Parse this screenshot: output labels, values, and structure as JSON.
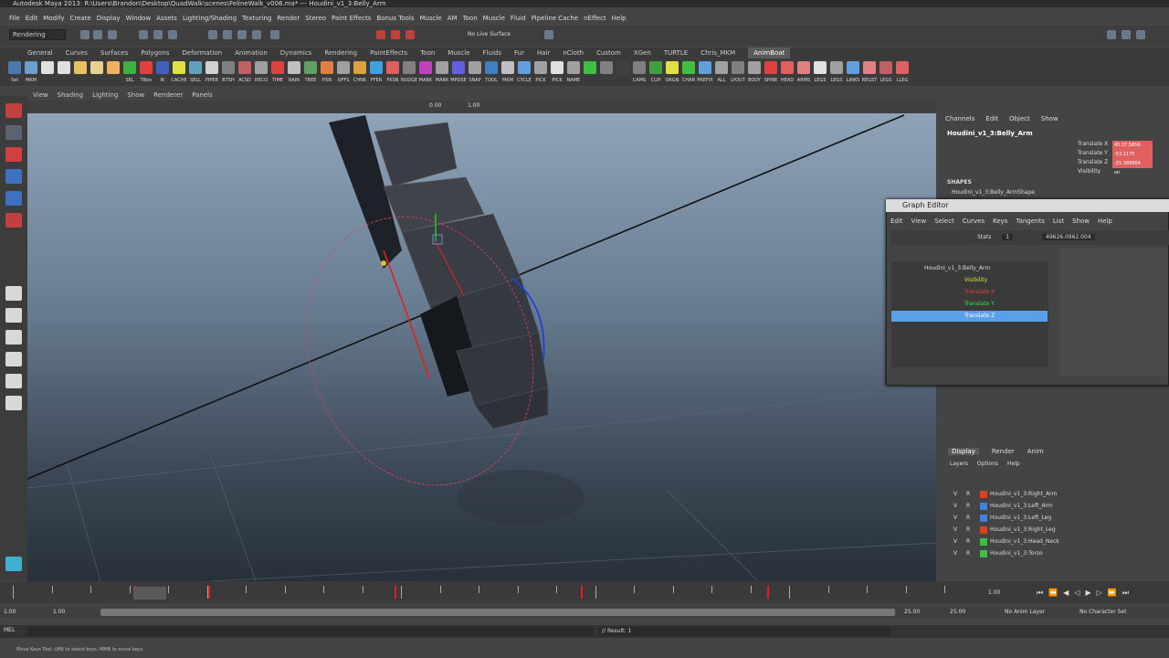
{
  "window": {
    "title": "Autodesk Maya 2013: R:\\Users\\Brandon\\Desktop\\QuadWalk\\scenes\\FelineWalk_v006.ma* --- Houdini_v1_3:Belly_Arm"
  },
  "menubar": [
    "File",
    "Edit",
    "Modify",
    "Create",
    "Display",
    "Window",
    "Assets",
    "Lighting/Shading",
    "Texturing",
    "Render",
    "Stereo",
    "Paint Effects",
    "Bonus Tools",
    "Muscle",
    "AM",
    "Toon",
    "Muscle",
    "Fluid",
    "Pipeline Cache",
    "nEffect",
    "Help"
  ],
  "status": {
    "menu_set": "Rendering",
    "live_surface_label": "No Live Surface"
  },
  "shelf_tabs": [
    {
      "label": "General",
      "active": false
    },
    {
      "label": "Curves",
      "active": false
    },
    {
      "label": "Surfaces",
      "active": false
    },
    {
      "label": "Polygons",
      "active": false
    },
    {
      "label": "Deformation",
      "active": false
    },
    {
      "label": "Animation",
      "active": false
    },
    {
      "label": "Dynamics",
      "active": false
    },
    {
      "label": "Rendering",
      "active": false
    },
    {
      "label": "PaintEffects",
      "active": false
    },
    {
      "label": "Toon",
      "active": false
    },
    {
      "label": "Muscle",
      "active": false
    },
    {
      "label": "Fluids",
      "active": false
    },
    {
      "label": "Fur",
      "active": false
    },
    {
      "label": "Hair",
      "active": false
    },
    {
      "label": "nCloth",
      "active": false
    },
    {
      "label": "Custom",
      "active": false
    },
    {
      "label": "XGen",
      "active": false
    },
    {
      "label": "TURTLE",
      "active": false
    },
    {
      "label": "Chris_MKM",
      "active": false
    },
    {
      "label": "AnimBoat",
      "active": true
    }
  ],
  "shelf_buttons": [
    {
      "label": "Sel",
      "color": "#4a7ab0"
    },
    {
      "label": "MKM",
      "color": "#6aa0d0"
    },
    {
      "label": "",
      "color": "#e0e0e0"
    },
    {
      "label": "",
      "color": "#e0e0e0"
    },
    {
      "label": "",
      "color": "#e8c060"
    },
    {
      "label": "",
      "color": "#e8d090"
    },
    {
      "label": "",
      "color": "#f0b060"
    },
    {
      "label": "SEL",
      "color": "#40b040"
    },
    {
      "label": "TBon",
      "color": "#e04040"
    },
    {
      "label": "IK",
      "color": "#4060c0"
    },
    {
      "label": "CACHE",
      "color": "#e0e040"
    },
    {
      "label": "SELL",
      "color": "#60a0c0"
    },
    {
      "label": "PIPER",
      "color": "#d0d0d0"
    },
    {
      "label": "BTSH",
      "color": "#808080"
    },
    {
      "label": "ACSD",
      "color": "#c06060"
    },
    {
      "label": "RECO",
      "color": "#a0a0a0"
    },
    {
      "label": "TIME",
      "color": "#e04040"
    },
    {
      "label": "RAIN",
      "color": "#c0c0c0"
    },
    {
      "label": "TREE",
      "color": "#60a060"
    },
    {
      "label": "PXN",
      "color": "#e08040"
    },
    {
      "label": "OFFS",
      "color": "#a0a0a0"
    },
    {
      "label": "CHNK",
      "color": "#e0a040"
    },
    {
      "label": "FFER",
      "color": "#40a0e0"
    },
    {
      "label": "FKSN",
      "color": "#e06060"
    },
    {
      "label": "NUDGE",
      "color": "#808080"
    },
    {
      "label": "MARK",
      "color": "#c040c0"
    },
    {
      "label": "MARK",
      "color": "#a0a0a0"
    },
    {
      "label": "MPOSE",
      "color": "#6060e0"
    },
    {
      "label": "SNAP",
      "color": "#a0a0a0"
    },
    {
      "label": "TOOL",
      "color": "#4080c0"
    },
    {
      "label": "MKM",
      "color": "#c0c0c0"
    },
    {
      "label": "CYCLE",
      "color": "#60a0e0"
    },
    {
      "label": "PICK",
      "color": "#a0a0a0"
    },
    {
      "label": "PICK",
      "color": "#e0e0e0"
    },
    {
      "label": "NAME",
      "color": "#a0a0a0"
    },
    {
      "label": "",
      "color": "#40c040"
    },
    {
      "label": "",
      "color": "#808080"
    },
    {
      "label": "",
      "color": "#404040"
    },
    {
      "label": "CAMS",
      "color": "#808080"
    },
    {
      "label": "CLIP",
      "color": "#40a040"
    },
    {
      "label": "ORGN",
      "color": "#e0e040"
    },
    {
      "label": "CHAR",
      "color": "#40c040"
    },
    {
      "label": "PREFIX",
      "color": "#60a0e0"
    },
    {
      "label": "ALL",
      "color": "#a0a0a0"
    },
    {
      "label": "LYOUT",
      "color": "#808080"
    },
    {
      "label": "BODY",
      "color": "#a0a0a0"
    },
    {
      "label": "SPINE",
      "color": "#e04040"
    },
    {
      "label": "HEAD",
      "color": "#e06060"
    },
    {
      "label": "ARMS",
      "color": "#e08080"
    },
    {
      "label": "LEGS",
      "color": "#e0e0e0"
    },
    {
      "label": "LEGS",
      "color": "#a0a0a0"
    },
    {
      "label": "LINKS",
      "color": "#60a0e0"
    },
    {
      "label": "REGST",
      "color": "#e08080"
    },
    {
      "label": "LEGS",
      "color": "#c06060"
    },
    {
      "label": "LLEG",
      "color": "#e06060"
    }
  ],
  "panel_menu": [
    "View",
    "Shading",
    "Lighting",
    "Show",
    "Renderer",
    "Panels"
  ],
  "panel_toolbar": {
    "field1": "0.00",
    "field2": "1.00"
  },
  "channel_box": {
    "menu": [
      "Channels",
      "Edit",
      "Object",
      "Show"
    ],
    "object_name": "Houdini_v1_3:Belly_Arm",
    "attributes": [
      {
        "name": "Translate X",
        "value": "45.37,5856"
      },
      {
        "name": "Translate Y",
        "value": "-53.1175"
      },
      {
        "name": "Translate Z",
        "value": "-15.389964"
      },
      {
        "name": "Visibility",
        "value": "on"
      }
    ],
    "shapes_label": "SHAPES",
    "shape_name": "Houdini_v1_3:Belly_ArmShape"
  },
  "graph_editor": {
    "title": "Graph Editor",
    "menu": [
      "Edit",
      "View",
      "Select",
      "Curves",
      "Keys",
      "Tangents",
      "List",
      "Show",
      "Help"
    ],
    "stats_label": "Stats",
    "stats_value": "1",
    "stats_value2": "49626.0962.004",
    "outliner": [
      {
        "label": "Houdini_v1_3:Belly_Arm",
        "color": "#ddd",
        "selected": false,
        "indent": 0
      },
      {
        "label": "Visibility",
        "color": "#e0e040",
        "selected": false,
        "indent": 1
      },
      {
        "label": "Translate X",
        "color": "#e04040",
        "selected": false,
        "indent": 1
      },
      {
        "label": "Translate Y",
        "color": "#40e040",
        "selected": false,
        "indent": 1
      },
      {
        "label": "Translate Z",
        "color": "#4080ff",
        "selected": true,
        "indent": 1
      }
    ]
  },
  "layer_editor": {
    "tabs": [
      {
        "label": "Display",
        "active": true
      },
      {
        "label": "Render",
        "active": false
      },
      {
        "label": "Anim",
        "active": false
      }
    ],
    "submenu": [
      "Layers",
      "Options",
      "Help"
    ],
    "layers": [
      {
        "v": "V",
        "r": "R",
        "color": "#e04020",
        "name": "Houdini_v1_3:Right_Arm"
      },
      {
        "v": "V",
        "r": "R",
        "color": "#4080e0",
        "name": "Houdini_v1_3:Left_Arm"
      },
      {
        "v": "V",
        "r": "R",
        "color": "#4080e0",
        "name": "Houdini_v1_3:Left_Leg"
      },
      {
        "v": "V",
        "r": "R",
        "color": "#e04020",
        "name": "Houdini_v1_3:Right_Leg"
      },
      {
        "v": "V",
        "r": "R",
        "color": "#40c040",
        "name": "Houdini_v1_3:Head_Neck"
      },
      {
        "v": "V",
        "r": "R",
        "color": "#40c040",
        "name": "Houdini_v1_3:Torso"
      }
    ]
  },
  "timeline": {
    "start": "1.00",
    "range_start": "1.00",
    "range_end": "25.00",
    "end": "25.00",
    "current": "1.00",
    "anim_layer": "No Anim Layer",
    "char_set": "No Character Set",
    "key_frames_pct": [
      0.13,
      0.21,
      0.41,
      0.61,
      0.81
    ]
  },
  "command": {
    "lang": "MEL",
    "result": "// Result: 1"
  },
  "helpline": "Move Keys Tool: LMB to select keys. MMB to move keys."
}
